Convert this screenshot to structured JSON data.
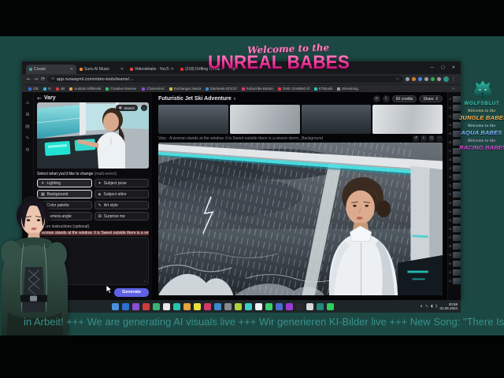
{
  "theme": {
    "accent_pink": "#f4429f",
    "accent_indigo": "#5f61e6",
    "ticker_teal": "#39918c",
    "background_teal": "#1c4843"
  },
  "overlay": {
    "welcome_script": "Welcome to the",
    "title": "UNREAL BABES",
    "ticker": "in Arbeit! +++ We are generating AI visuals live +++ Wir generieren KI-Bilder live +++ New Song: \"There Is a Storm Insid",
    "wolf_name": "WOLFSBLUT",
    "badges": [
      {
        "script": "Welcome to the",
        "sc": "#ffd9a0",
        "title": "JUNGLE BABES",
        "from": "#ffe27a",
        "to": "#ff7b1c"
      },
      {
        "script": "Welcome to the",
        "sc": "#bfe2ff",
        "title": "AQUA BABES",
        "from": "#c9ecff",
        "to": "#2f7fe8"
      },
      {
        "script": "Welcome to the",
        "sc": "#ffb3ef",
        "title": "RACING BABES",
        "from": "#ff72e2",
        "to": "#a21cb8"
      }
    ]
  },
  "browser": {
    "tabs": [
      {
        "title": "Create",
        "color": "#3a9e94",
        "active": true,
        "close": "✕"
      },
      {
        "title": "Suno AI Music",
        "color": "#e8833b",
        "active": false,
        "close": "✕"
      },
      {
        "title": "Videodetails - YouTube Studio",
        "color": "#e04444",
        "active": false,
        "close": "✕"
      },
      {
        "title": "(218) Drifting Through the Sto...",
        "color": "#e02b2b",
        "active": false,
        "close": "✕"
      }
    ],
    "new_tab": "+",
    "window_controls": [
      "—",
      "▢",
      "✕"
    ],
    "nav_icons": [
      "←",
      "→",
      "⟳"
    ],
    "lock_icon": "⊙",
    "url": "app.runwayml.com/video-tools/teams/…",
    "star_icon": "☆",
    "ext_icons": [
      "#9aa0a6",
      "#c9842f",
      "#4a8af0",
      "#9aa0a6",
      "#34a853",
      "#9aa0a6"
    ],
    "menu_icon": "⋮",
    "bookmarks": [
      {
        "label": "GB",
        "color": "#3b6ad0"
      },
      {
        "label": "IX",
        "color": "#35b2d0"
      },
      {
        "label": "4B",
        "color": "#d03b3b"
      },
      {
        "label": "Audials Hilfeleiste…",
        "color": "#e8a23b"
      },
      {
        "label": "Creative Review Da…",
        "color": "#35c06a"
      },
      {
        "label": "ChannelAd",
        "color": "#8a4fd0"
      },
      {
        "label": "Exchanges Musik M…",
        "color": "#d0c23b"
      },
      {
        "label": "Startseite DOCSY e.V.",
        "color": "#3b8ad0"
      },
      {
        "label": "Subscribe Button/Y…",
        "color": "#d03b6a"
      },
      {
        "label": "OMG GAMING RUL…",
        "color": "#e03b3b"
      },
      {
        "label": "KTMusik",
        "color": "#35c0b4"
      },
      {
        "label": "Streaming",
        "color": "#9a9aa0"
      }
    ],
    "bookmarks_more": "»"
  },
  "app": {
    "back_icon": "←",
    "panel_title": "Vary",
    "rail_icons": [
      "⌂",
      "⊞",
      "▤",
      "✎",
      "⚙"
    ],
    "sketch_icon": "◐",
    "sketch_label": "Sketch",
    "info_icon": "i",
    "select_label": "Select what you'd like to change",
    "select_hint": " (multi-select)",
    "options": [
      {
        "label": "Lighting",
        "icon": "☀",
        "selected": true
      },
      {
        "label": "Subject pose",
        "icon": "✦",
        "selected": false
      },
      {
        "label": "Background",
        "icon": "▦",
        "selected": true
      },
      {
        "label": "Subject attire",
        "icon": "◈",
        "selected": false
      },
      {
        "label": "Color palette",
        "icon": "◐",
        "selected": false
      },
      {
        "label": "Art style",
        "icon": "✎",
        "selected": false
      },
      {
        "label": "Camera angle",
        "icon": "◉",
        "selected": false
      },
      {
        "label": "Surprise me",
        "icon": "⚄",
        "selected": false
      }
    ],
    "instructions_label": "Custom instructions (optional)",
    "prompt_text": "A woman stands at the window. It is Sweet outside there is a severe storm.",
    "expand_icon": "⌟",
    "generate_label": "Generate",
    "session_title": "Futuristic Jet Ski Adventure",
    "session_caret": "▾",
    "toolbar_icons": [
      "◷",
      "⇩"
    ],
    "credits_label": "60 credits",
    "share_label": "Share",
    "share_icon": "↥",
    "caption": "Vary · A woman stands at the window. It is Sweet outside there is a severe storm._Background",
    "image_actions": [
      "↺",
      "↓",
      "◱",
      "⋯"
    ],
    "history": [
      "21",
      "22",
      "23",
      "24",
      "25",
      "26",
      "27",
      "28",
      "29",
      "30",
      "31",
      "32",
      "33",
      "34",
      "35",
      "36",
      "37",
      "38",
      "39",
      "40",
      "41",
      "42"
    ]
  },
  "taskbar": {
    "icons": [
      {
        "c": "#4a90d9"
      },
      {
        "c": "#2f6fd0"
      },
      {
        "c": "#8a4fd0"
      },
      {
        "c": "#d03b3b"
      },
      {
        "c": "#3bb273"
      },
      {
        "c": "#e8e8e8"
      },
      {
        "c": "#27c3b0"
      },
      {
        "c": "#e8a33b"
      },
      {
        "c": "#e8e13b"
      },
      {
        "c": "#d03b6a"
      },
      {
        "c": "#3b8ad0"
      },
      {
        "c": "#8a8a8a"
      },
      {
        "c": "#b0d03b"
      },
      {
        "c": "#3bd0c3"
      },
      {
        "c": "#f2f2f2"
      },
      {
        "c": "#3bd06a"
      },
      {
        "c": "#4a6ad0"
      },
      {
        "c": "#9a3bd0"
      },
      {
        "c": "#2a2a2e"
      },
      {
        "c": "#d8d8d8"
      },
      {
        "c": "#27867e"
      },
      {
        "c": "#2fd05a"
      }
    ],
    "tray_icons": [
      "∧",
      "∿",
      "◖",
      "▯"
    ],
    "clock_time": "20:58",
    "clock_date": "01.05.2024"
  }
}
